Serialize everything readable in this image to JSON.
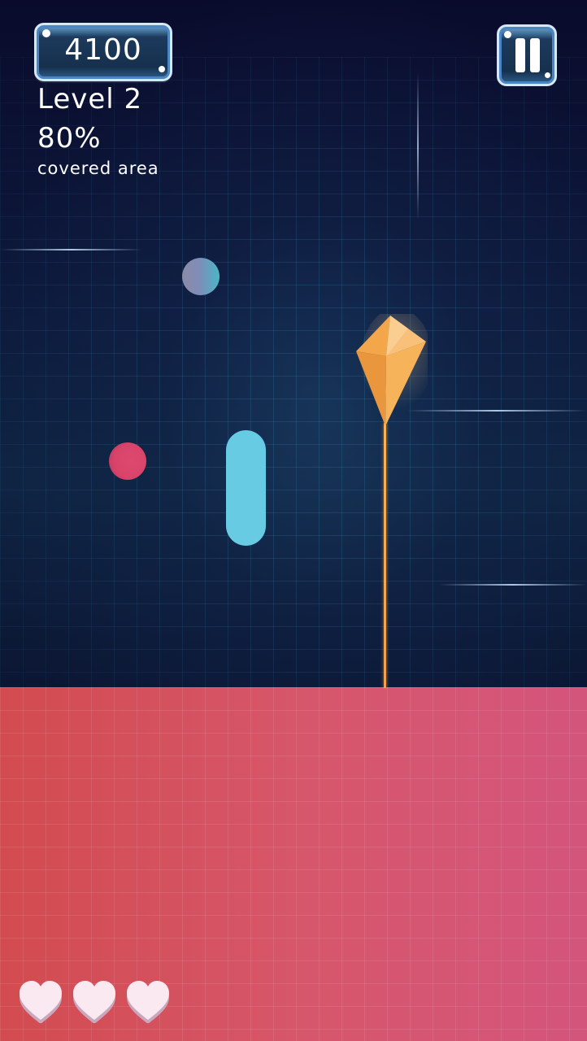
{
  "hud": {
    "score": "4100",
    "level": "Level 2",
    "covered_percent": "80%",
    "covered_caption": "covered area",
    "pause_icon": "pause-icon"
  },
  "colors": {
    "covered_area_start": "#d24b4f",
    "covered_area_end": "#d4557c",
    "paddle": "#66cbe3",
    "ball_red": "#d8436a",
    "ball_gray": "#8c8aa6",
    "kite": "#f2ad5a",
    "heart": "#fbe9f2"
  },
  "objects": [
    {
      "name": "ball-gray",
      "icon": "ball-icon"
    },
    {
      "name": "ball-red",
      "icon": "ball-icon"
    },
    {
      "name": "paddle",
      "icon": "capsule-icon"
    },
    {
      "name": "kite",
      "icon": "kite-icon"
    }
  ],
  "lives": {
    "count": 3,
    "icon": "heart-icon"
  }
}
